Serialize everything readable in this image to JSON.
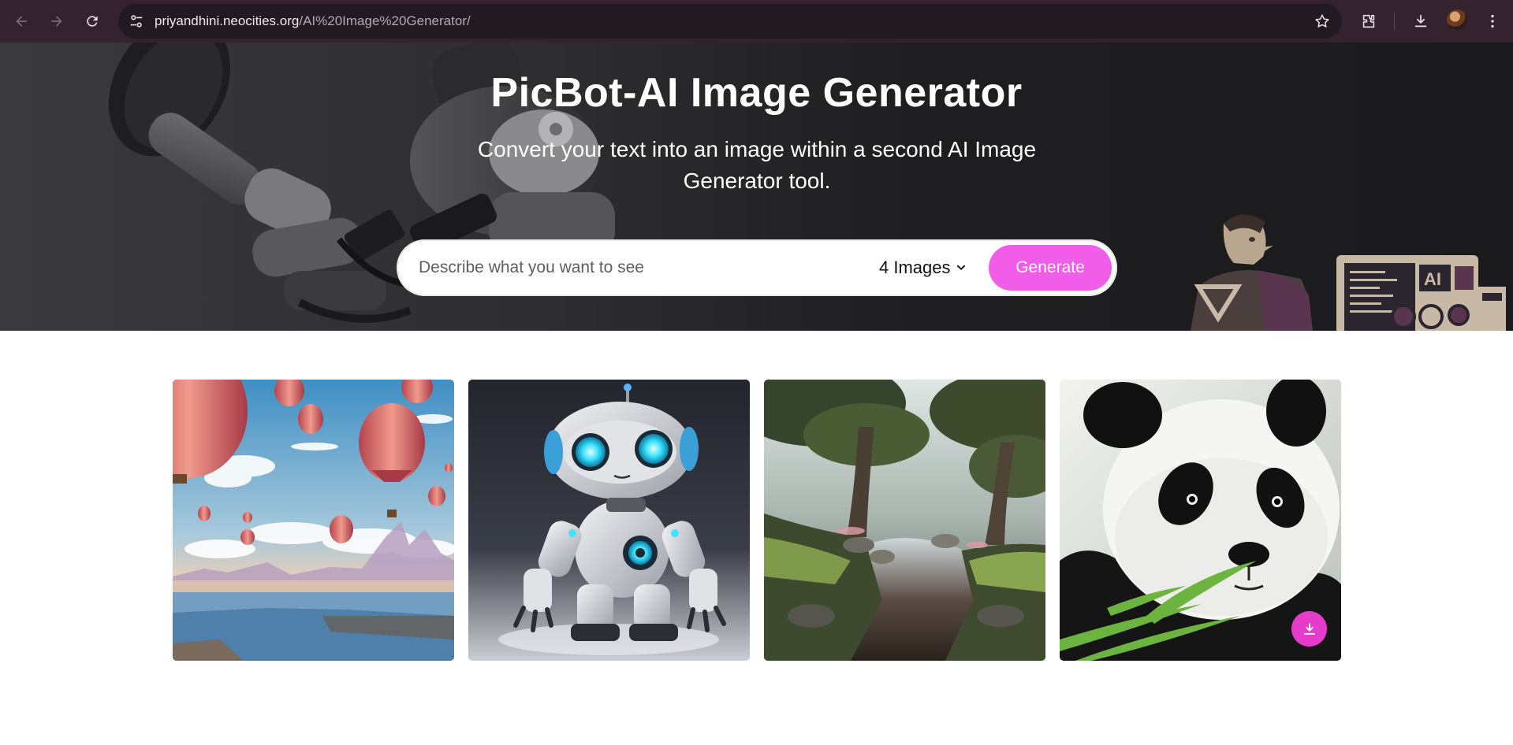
{
  "browser": {
    "url_host": "priyandhini.neocities.org",
    "url_path": "/AI%20Image%20Generator/"
  },
  "hero": {
    "title": "PicBot-AI Image Generator",
    "subtitle": "Convert your text into an image within a second AI Image Generator tool."
  },
  "search": {
    "placeholder": "Describe what you want to see",
    "image_count": "4 Images",
    "generate_label": "Generate"
  },
  "person_art": {
    "screen_text": "AI"
  },
  "gallery": {
    "images": [
      {
        "subject": "hot air balloons over a canyon lake"
      },
      {
        "subject": "cute white robot with glowing blue eyes"
      },
      {
        "subject": "forest stream with trees at sunrise"
      },
      {
        "subject": "panda eating bamboo"
      }
    ]
  },
  "colors": {
    "accent": "#f15ce8",
    "download": "#e63ccc",
    "chrome": "#34232f"
  }
}
